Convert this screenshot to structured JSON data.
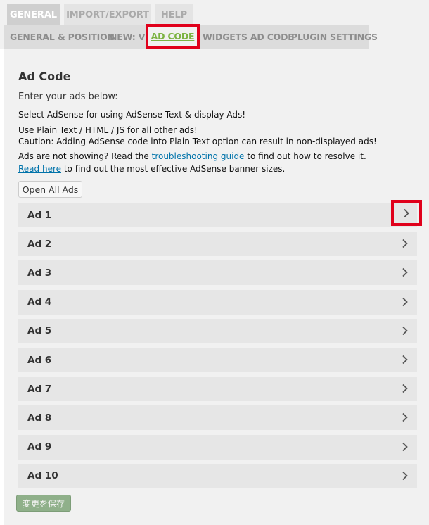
{
  "top_tabs": [
    {
      "label": "GENERAL"
    },
    {
      "label": "IMPORT/EXPORT"
    },
    {
      "label": "HELP"
    }
  ],
  "sub_tabs": [
    {
      "label": "GENERAL & POSITION"
    },
    {
      "label": "NEW: VI"
    },
    {
      "label": "AD CODE"
    },
    {
      "label": "WIDGETS AD CODE"
    },
    {
      "label": "PLUGIN SETTINGS"
    }
  ],
  "section": {
    "title": "Ad Code",
    "intro": "Enter your ads below:",
    "line1": "Select AdSense for using AdSense Text & display Ads!",
    "line2": "Use Plain Text / HTML / JS for all other ads!",
    "line3": "Caution: Adding AdSense code into Plain Text option can result in non-displayed ads!",
    "line4_pre": "Ads are not showing? Read the ",
    "line4_link": "troubleshooting guide",
    "line4_post": " to find out how to resolve it.",
    "line5_link": "Read here",
    "line5_post": " to find out the most effective AdSense banner sizes.",
    "open_all": "Open All Ads",
    "save": "変更を保存"
  },
  "ads": [
    {
      "label": "Ad 1"
    },
    {
      "label": "Ad 2"
    },
    {
      "label": "Ad 3"
    },
    {
      "label": "Ad 4"
    },
    {
      "label": "Ad 5"
    },
    {
      "label": "Ad 6"
    },
    {
      "label": "Ad 7"
    },
    {
      "label": "Ad 8"
    },
    {
      "label": "Ad 9"
    },
    {
      "label": "Ad 10"
    }
  ],
  "colors": {
    "active_tab_text": "#7cb342",
    "highlight_box": "#e0001b",
    "link": "#0073aa",
    "save_button": "#8fb08a"
  },
  "icons": {
    "expand": "chevron-right-icon"
  }
}
